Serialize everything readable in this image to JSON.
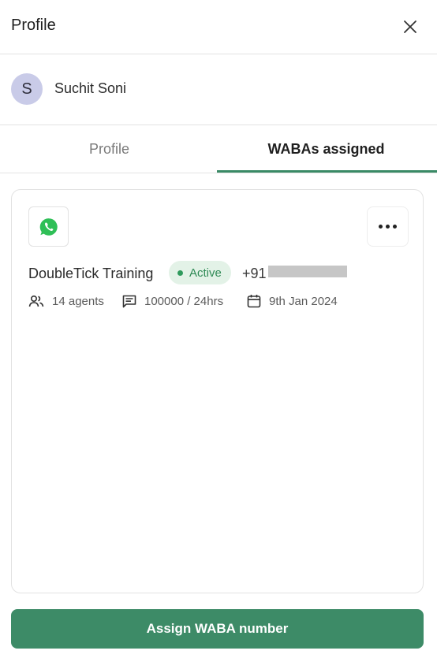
{
  "header": {
    "title": "Profile",
    "close_icon": "close-icon"
  },
  "user": {
    "avatar_initial": "S",
    "name": "Suchit Soni",
    "avatar_color": "#c9cbe8"
  },
  "tabs": [
    {
      "label": "Profile",
      "active": false
    },
    {
      "label": "WABAs assigned",
      "active": true
    }
  ],
  "waba_card": {
    "app_icon": "whatsapp-icon",
    "more_icon": "more-horizontal-icon",
    "name": "DoubleTick Training",
    "status": "Active",
    "phone_prefix": "+91",
    "agents": "14 agents",
    "limit": "100000 / 24hrs",
    "date": "9th Jan 2024"
  },
  "actions": {
    "assign_label": "Assign WABA number"
  },
  "colors": {
    "accent": "#3d8b67",
    "status_bg": "#e3f2e7",
    "status_text": "#2f8a55",
    "border": "#e2e2e2"
  }
}
